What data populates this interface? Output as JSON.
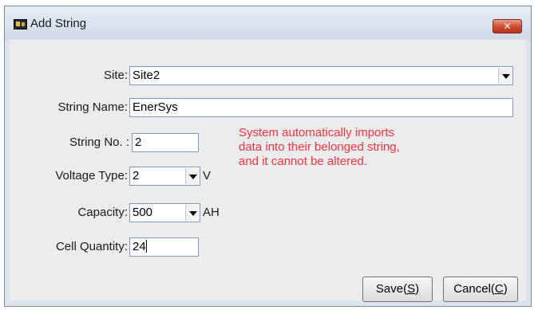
{
  "window": {
    "title": "Add String",
    "close_label": "✕"
  },
  "form": {
    "site": {
      "label": "Site:",
      "value": "Site2"
    },
    "string_name": {
      "label": "String Name:",
      "value": "EnerSys"
    },
    "string_no": {
      "label": "String No. :",
      "value": "2"
    },
    "voltage_type": {
      "label": "Voltage Type:",
      "value": "2",
      "unit": "V"
    },
    "capacity": {
      "label": "Capacity:",
      "value": "500",
      "unit": "AH"
    },
    "cell_quantity": {
      "label": "Cell Quantity:",
      "value": "24"
    }
  },
  "note": {
    "lines": [
      "System automatically imports",
      "data into their belonged string,",
      "and it cannot be altered."
    ],
    "color": "#ff3040"
  },
  "buttons": {
    "save": {
      "text": "Save(",
      "mnemonic": "S",
      "suffix": ")"
    },
    "cancel": {
      "text": "Cancel(",
      "mnemonic": "C",
      "suffix": ")"
    }
  }
}
